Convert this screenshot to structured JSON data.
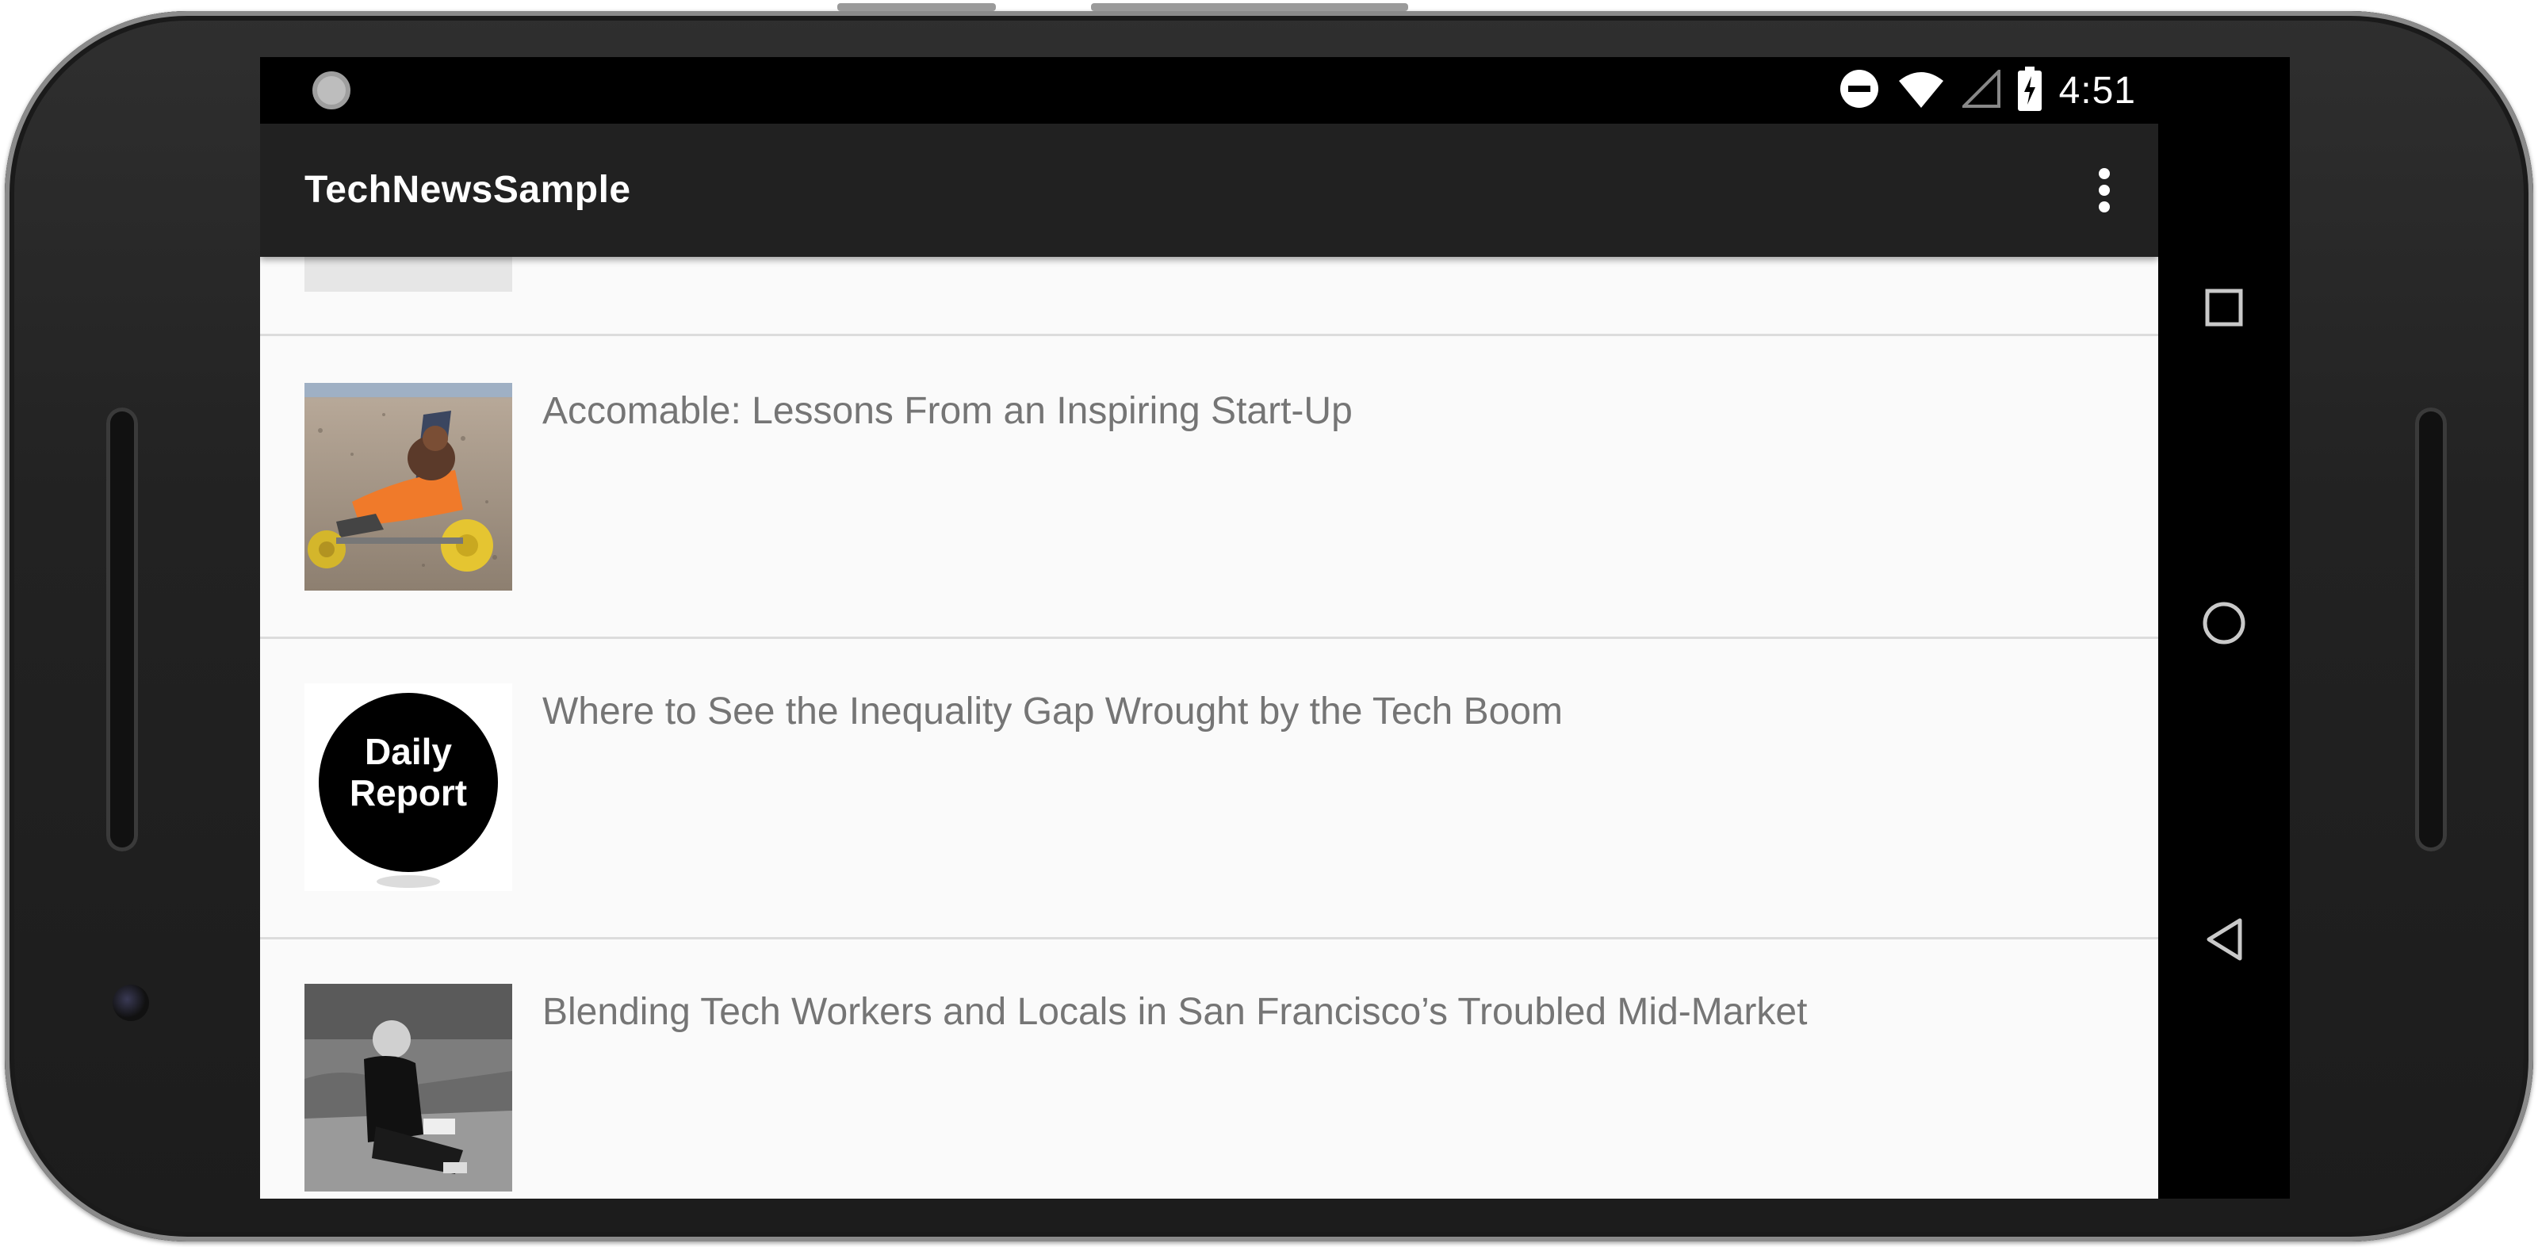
{
  "status_bar": {
    "time": "4:51",
    "icons": [
      "sync-icon",
      "do-not-disturb-icon",
      "wifi-icon",
      "cell-signal-icon",
      "battery-charging-icon"
    ]
  },
  "app_bar": {
    "title": "TechNewsSample",
    "menu_icon": "overflow-menu-icon"
  },
  "articles": [
    {
      "title": "Accomable: Lessons From an Inspiring Start-Up",
      "thumbnail": "beach-wheelchair-photo"
    },
    {
      "title": "Where to See the Inequality Gap Wrought by the Tech Boom",
      "thumbnail": "daily-report-logo",
      "logo_text": "Daily Report"
    },
    {
      "title": "Blending Tech Workers and Locals in San Francisco’s Troubled Mid-Market",
      "thumbnail": "street-bw-photo"
    }
  ],
  "nav_bar": {
    "buttons": [
      "recents-icon",
      "home-icon",
      "back-icon"
    ]
  }
}
